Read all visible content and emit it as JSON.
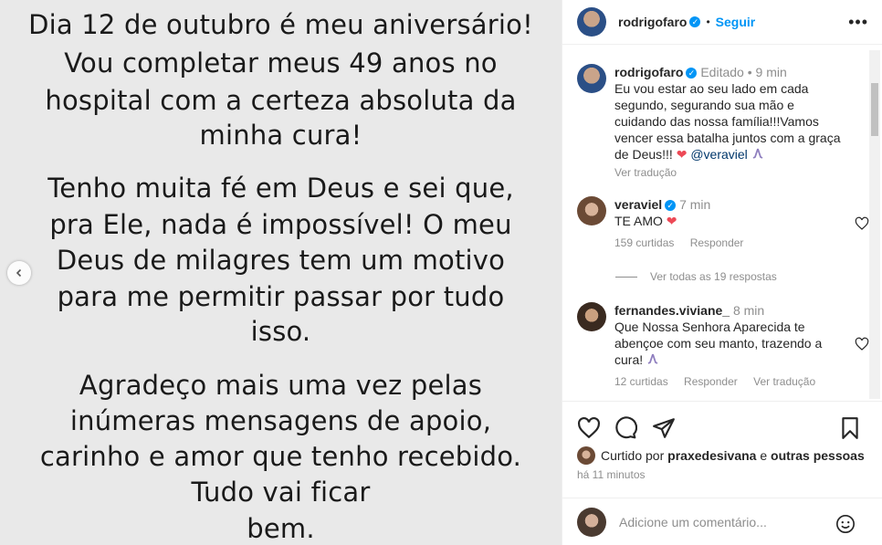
{
  "post_image": {
    "lines": [
      "Dia 12 de outubro é meu aniversário!",
      "Vou completar meus 49 anos no",
      "hospital com a certeza absoluta da",
      "minha cura!",
      "Tenho muita fé em Deus e sei que,",
      "pra Ele, nada é impossível! O meu",
      "Deus de milagres tem um motivo",
      "para me permitir passar por tudo",
      "isso.",
      "Agradeço mais uma vez pelas",
      "inúmeras mensagens de apoio,",
      "carinho e amor que tenho recebido.",
      "Tudo vai ficar",
      "bem."
    ]
  },
  "header": {
    "username": "rodrigofaro",
    "separator": "•",
    "follow_label": "Seguir",
    "verified_icon": "verified-check-icon",
    "more_icon": "more-options-icon"
  },
  "caption": {
    "username": "rodrigofaro",
    "edited": "Editado",
    "separator": "•",
    "time": "9 min",
    "text": "Eu vou estar ao seu lado em cada segundo, segurando sua mão e cuidando das nossa família!!!Vamos vencer essa batalha juntos com a graça de Deus!!!",
    "heart": "❤",
    "mention": "@veraviel",
    "translate": "Ver tradução"
  },
  "comments": [
    {
      "username": "veraviel",
      "time": "7 min",
      "text": "TE AMO",
      "heart": "❤",
      "likes": "159 curtidas",
      "reply": "Responder",
      "view_replies": "Ver todas as 19 respostas"
    },
    {
      "username": "fernandes.viviane_",
      "time": "8 min",
      "text": "Que Nossa Senhora Aparecida te abençoe com seu manto, trazendo a cura!",
      "likes": "12 curtidas",
      "reply": "Responder",
      "translate": "Ver tradução"
    }
  ],
  "likes": {
    "prefix": "Curtido por",
    "user": "praxedesivana",
    "joiner": "e",
    "others": "outras pessoas"
  },
  "timestamp": "há 11 minutos",
  "comment_box": {
    "placeholder": "Adicione um comentário..."
  },
  "colors": {
    "accent": "#0095f6",
    "heart": "#ed4956",
    "muted": "#8e8e8e",
    "image_bg": "#e9e9e9"
  }
}
